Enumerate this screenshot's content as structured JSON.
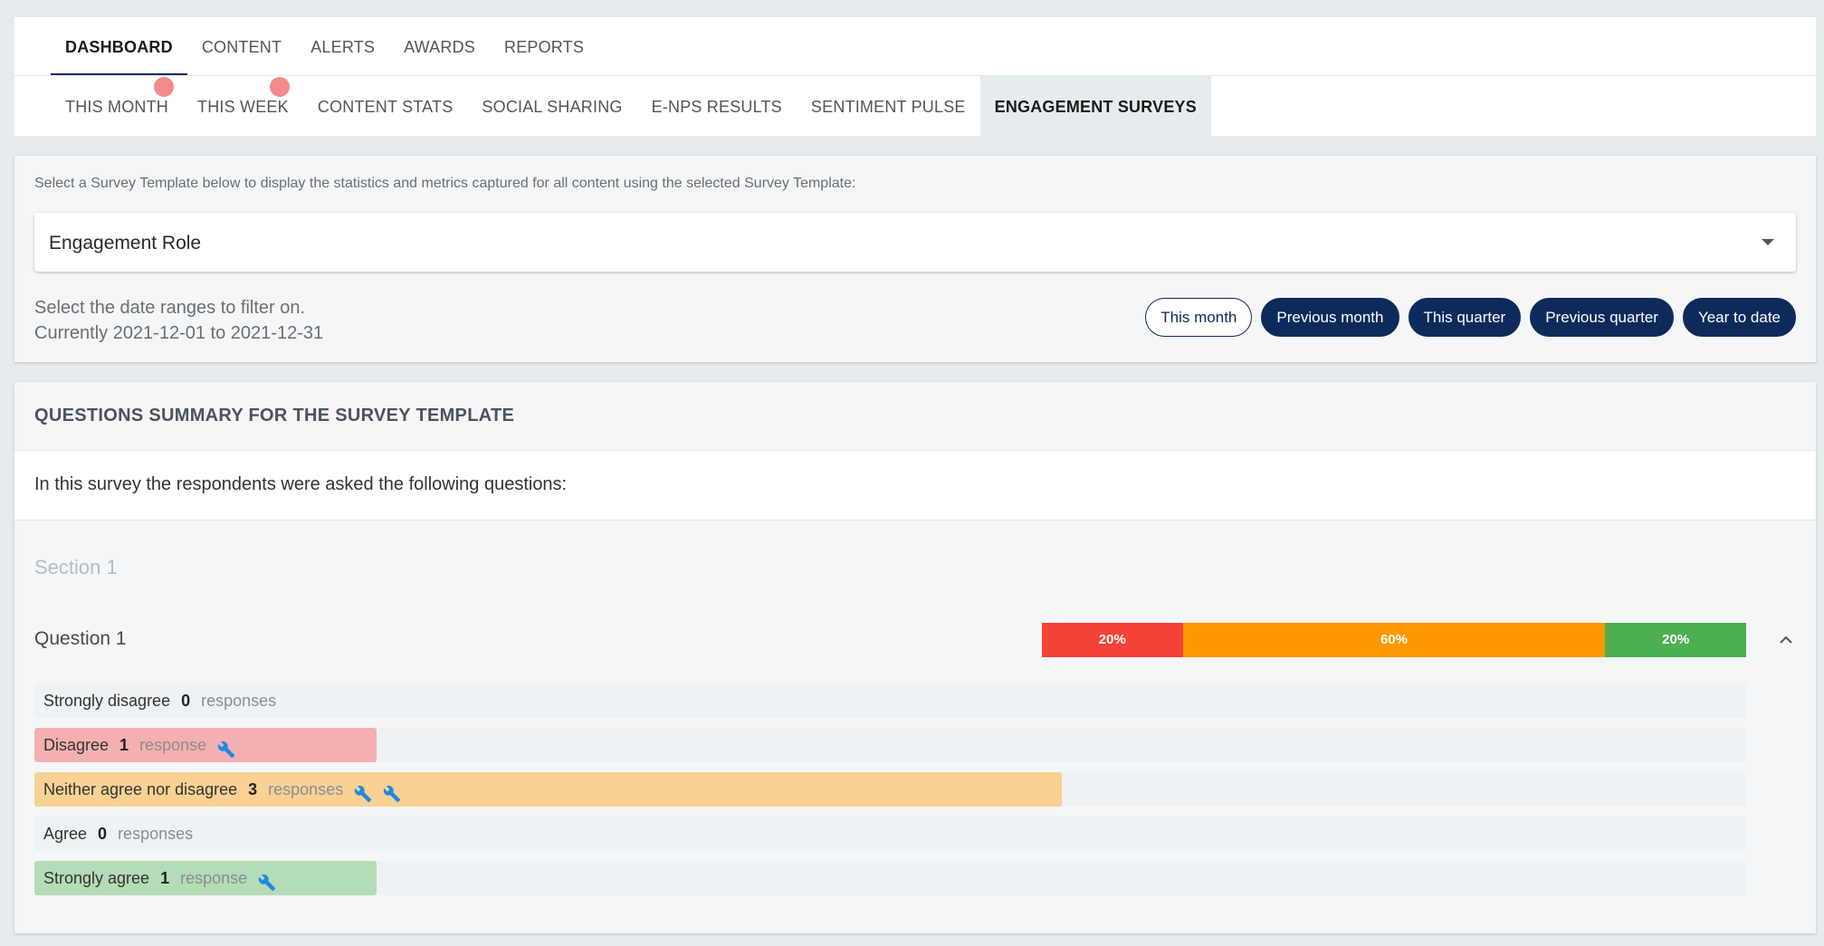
{
  "nav": {
    "main_tabs": [
      "DASHBOARD",
      "CONTENT",
      "ALERTS",
      "AWARDS",
      "REPORTS"
    ],
    "sub_tabs": [
      "THIS MONTH",
      "THIS WEEK",
      "CONTENT STATS",
      "SOCIAL SHARING",
      "E-NPS RESULTS",
      "SENTIMENT PULSE",
      "ENGAGEMENT SURVEYS"
    ]
  },
  "filter": {
    "prompt": "Select a Survey Template below to display the statistics and metrics captured for all content using the selected Survey Template:",
    "selected_template": "Engagement Role",
    "date_label": "Select the date ranges to filter on.",
    "date_current": "Currently 2021-12-01 to 2021-12-31",
    "buttons": [
      "This month",
      "Previous month",
      "This quarter",
      "Previous quarter",
      "Year to date"
    ]
  },
  "summary": {
    "title": "QUESTIONS SUMMARY FOR THE SURVEY TEMPLATE",
    "intro": "In this survey the respondents were asked the following questions:",
    "section_title": "Section 1",
    "question_title": "Question 1",
    "stacked": [
      {
        "label": "20%",
        "value": 20,
        "color": "#f44336"
      },
      {
        "label": "60%",
        "value": 60,
        "color": "#ff9800"
      },
      {
        "label": "20%",
        "value": 20,
        "color": "#4caf50"
      }
    ],
    "answers": [
      {
        "label": "Strongly disagree",
        "count": "0",
        "unit": "responses",
        "fraction": 0,
        "color": "#eff2f4",
        "wrenches": 0
      },
      {
        "label": "Disagree",
        "count": "1",
        "unit": "response",
        "fraction": 0.2,
        "color": "#f4b0b0",
        "wrenches": 1
      },
      {
        "label": "Neither agree nor disagree",
        "count": "3",
        "unit": "responses",
        "fraction": 0.6,
        "color": "#f8d193",
        "wrenches": 2
      },
      {
        "label": "Agree",
        "count": "0",
        "unit": "responses",
        "fraction": 0,
        "color": "#eff2f4",
        "wrenches": 0
      },
      {
        "label": "Strongly agree",
        "count": "1",
        "unit": "response",
        "fraction": 0.2,
        "color": "#b4dcb6",
        "wrenches": 1
      }
    ]
  },
  "icons": {
    "caret": "chevron-down-icon",
    "collapse": "chevron-up-icon",
    "wrench": "wrench-icon",
    "wrench_color": "#1e88e5"
  }
}
